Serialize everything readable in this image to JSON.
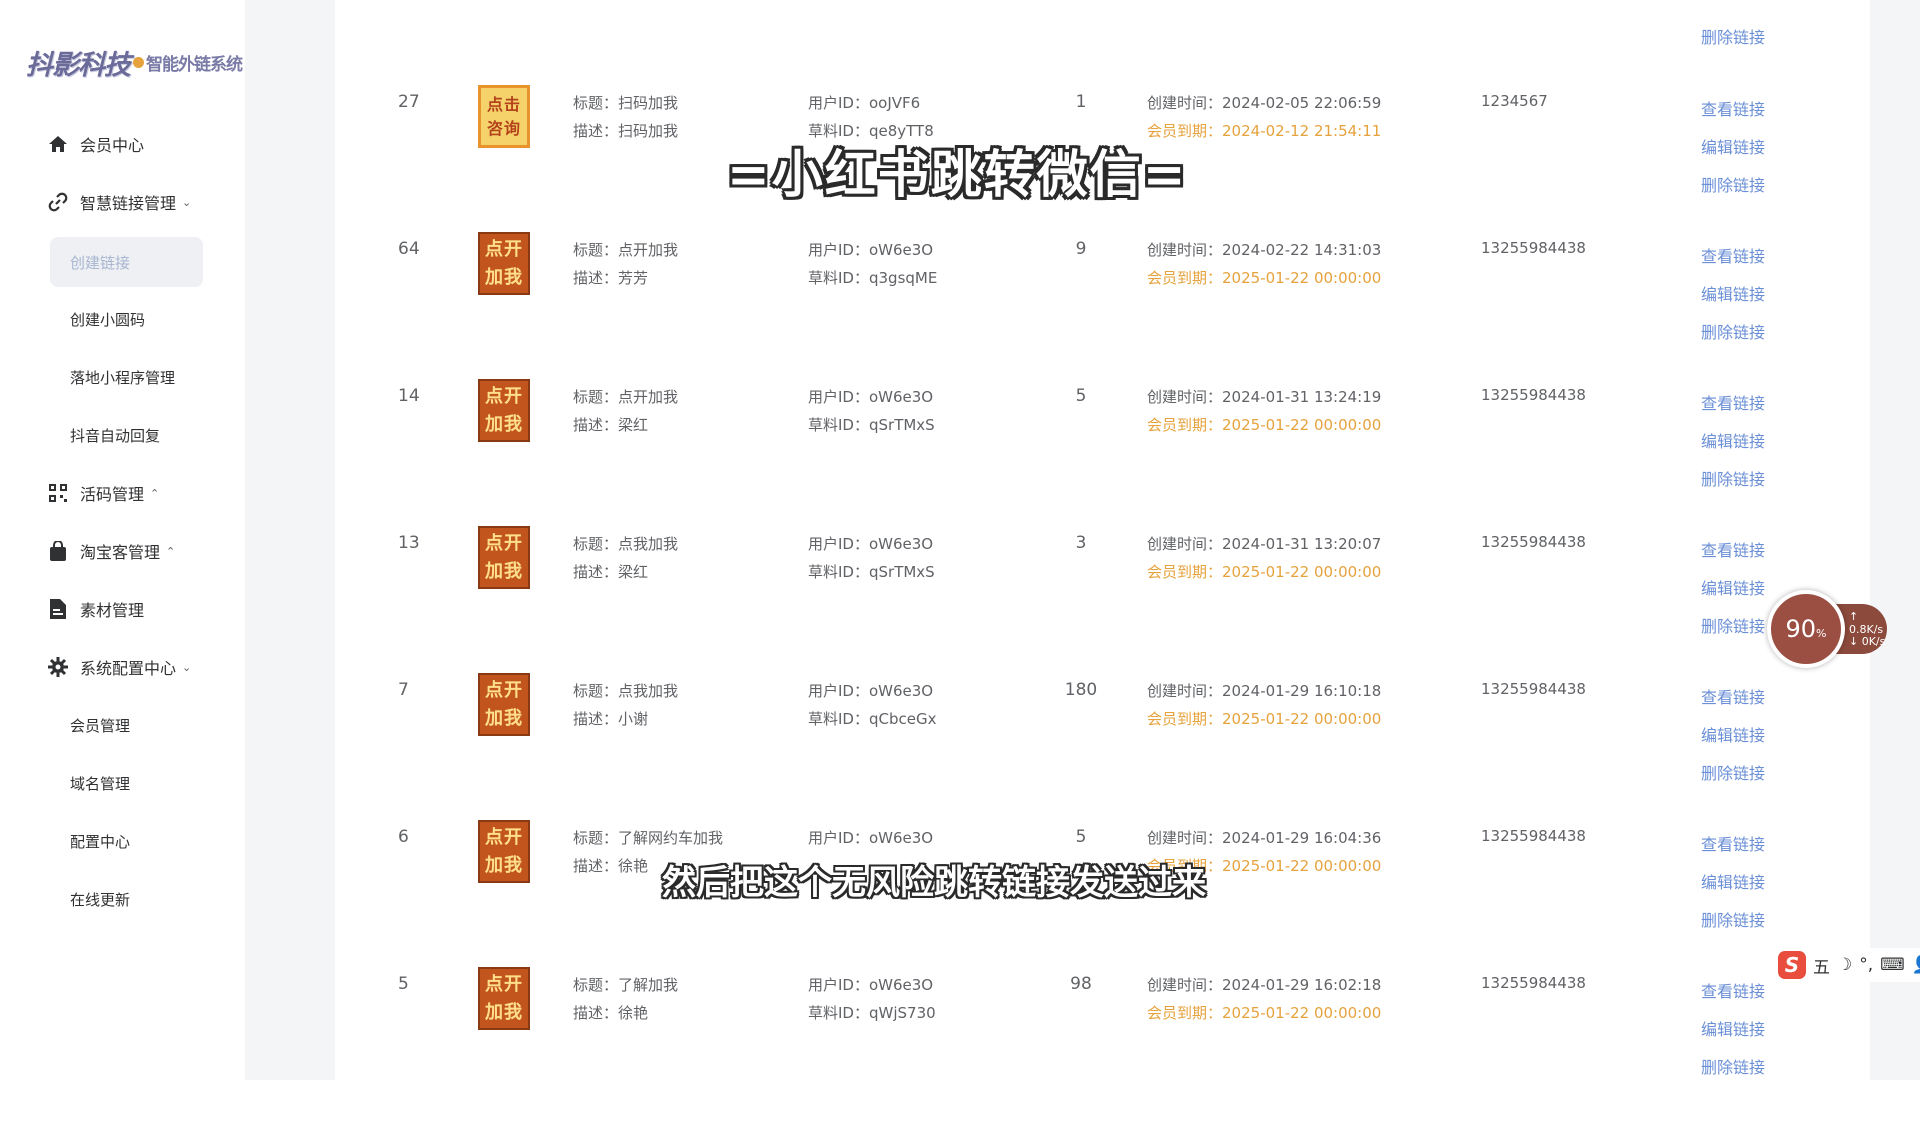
{
  "app": {
    "logo_main": "抖影科技",
    "logo_sub": "智能外链系统"
  },
  "sidebar": {
    "items": [
      {
        "label": "会员中心",
        "icon": "home-icon"
      },
      {
        "label": "智慧链接管理",
        "icon": "link-icon",
        "chevron": "⌄"
      },
      {
        "label": "创建链接",
        "active": true
      },
      {
        "label": "创建小圆码"
      },
      {
        "label": "落地小程序管理"
      },
      {
        "label": "抖音自动回复"
      },
      {
        "label": "活码管理",
        "icon": "qrcode-icon",
        "chevron": "⌃"
      },
      {
        "label": "淘宝客管理",
        "icon": "bag-icon",
        "chevron": "⌃"
      },
      {
        "label": "素材管理",
        "icon": "file-icon"
      },
      {
        "label": "系统配置中心",
        "icon": "gear-icon",
        "chevron": "⌄"
      },
      {
        "label": "会员管理"
      },
      {
        "label": "域名管理"
      },
      {
        "label": "配置中心"
      },
      {
        "label": "在线更新"
      }
    ]
  },
  "labels": {
    "title_prefix": "标题：",
    "desc_prefix": "描述：",
    "user_prefix": "用户ID：",
    "draft_prefix": "草料ID：",
    "created_prefix": "创建时间：",
    "expire_prefix": "会员到期：",
    "view_link": "查看链接",
    "edit_link": "编辑链接",
    "delete_link": "删除链接"
  },
  "rows": [
    {
      "id": "27",
      "thumb_top": "点击",
      "thumb_bottom": "咨询",
      "title": "扫码加我",
      "desc": "扫码加我",
      "user_id": "ooJVF6",
      "draft_id": "qe8yTT8",
      "count": "1",
      "created": "2024-02-05 22:06:59",
      "expire": "2024-02-12 21:54:11",
      "phone": "1234567"
    },
    {
      "id": "64",
      "thumb_top": "点开",
      "thumb_bottom": "加我",
      "title": "点开加我",
      "desc": "芳芳",
      "user_id": "oW6e3O",
      "draft_id": "q3gsqME",
      "count": "9",
      "created": "2024-02-22 14:31:03",
      "expire": "2025-01-22 00:00:00",
      "phone": "13255984438"
    },
    {
      "id": "14",
      "thumb_top": "点开",
      "thumb_bottom": "加我",
      "title": "点开加我",
      "desc": "梁红",
      "user_id": "oW6e3O",
      "draft_id": "qSrTMxS",
      "count": "5",
      "created": "2024-01-31 13:24:19",
      "expire": "2025-01-22 00:00:00",
      "phone": "13255984438"
    },
    {
      "id": "13",
      "thumb_top": "点开",
      "thumb_bottom": "加我",
      "title": "点我加我",
      "desc": "梁红",
      "user_id": "oW6e3O",
      "draft_id": "qSrTMxS",
      "count": "3",
      "created": "2024-01-31 13:20:07",
      "expire": "2025-01-22 00:00:00",
      "phone": "13255984438"
    },
    {
      "id": "7",
      "thumb_top": "点开",
      "thumb_bottom": "加我",
      "title": "点我加我",
      "desc": "小谢",
      "user_id": "oW6e3O",
      "draft_id": "qCbceGx",
      "count": "180",
      "created": "2024-01-29 16:10:18",
      "expire": "2025-01-22 00:00:00",
      "phone": "13255984438"
    },
    {
      "id": "6",
      "thumb_top": "点开",
      "thumb_bottom": "加我",
      "title": "了解网约车加我",
      "desc": "徐艳",
      "user_id": "oW6e3O",
      "draft_id": "",
      "count": "5",
      "created": "2024-01-29 16:04:36",
      "expire": "2025-01-22 00:00:00",
      "phone": "13255984438"
    },
    {
      "id": "5",
      "thumb_top": "点开",
      "thumb_bottom": "加我",
      "title": "了解加我",
      "desc": "徐艳",
      "user_id": "oW6e3O",
      "draft_id": "qWjS730",
      "count": "98",
      "created": "2024-01-29 16:02:18",
      "expire": "2025-01-22 00:00:00",
      "phone": "13255984438"
    }
  ],
  "top_partial": {
    "delete_link": "删除链接"
  },
  "overlay": {
    "title": "=小红书跳转微信=",
    "subtitle": "然后把这个无风险跳转链接发送过来"
  },
  "net_widget": {
    "percent": "90",
    "percent_unit": "%",
    "up": "↑ 0.8K/s",
    "down": "↓ 0K/s"
  },
  "ime": {
    "logo": "S",
    "items": [
      "五",
      "☽",
      "°,",
      "⌨",
      "👤"
    ]
  },
  "colors": {
    "link": "#6b8fd6",
    "expire_value": "#e6a23c",
    "thumb_bg": "#c2551e",
    "thumb_text": "#ffe08a"
  }
}
